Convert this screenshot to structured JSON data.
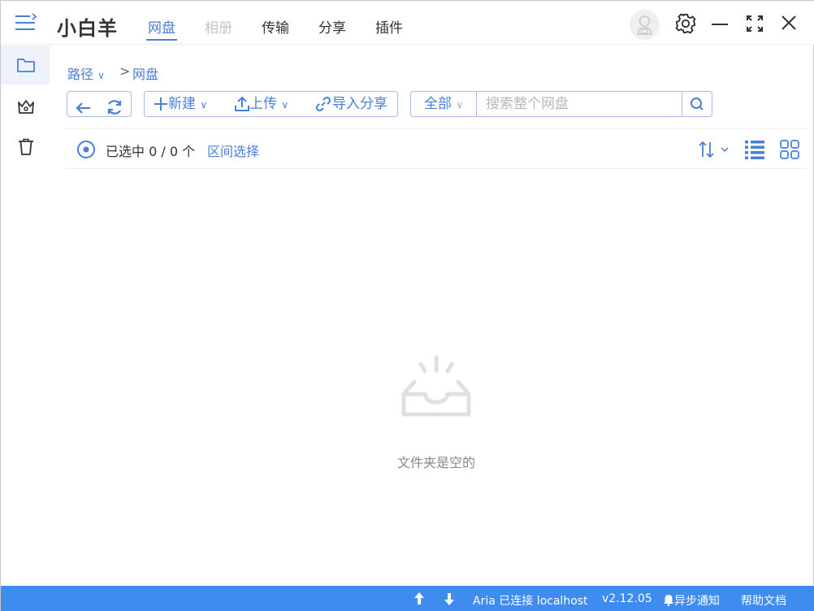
{
  "app": {
    "title": "小白羊"
  },
  "nav": {
    "tabs": [
      {
        "label": "网盘",
        "state": "active"
      },
      {
        "label": "相册",
        "state": "disabled"
      },
      {
        "label": "传输",
        "state": "normal"
      },
      {
        "label": "分享",
        "state": "normal"
      },
      {
        "label": "插件",
        "state": "normal"
      }
    ]
  },
  "window_controls": [
    "settings-icon",
    "minimize-icon",
    "maximize-icon",
    "close-icon"
  ],
  "sidebar": {
    "items": [
      {
        "icon": "folder-icon",
        "active": true
      },
      {
        "icon": "crown-icon",
        "active": false
      },
      {
        "icon": "trash-icon",
        "active": false
      }
    ]
  },
  "breadcrumb": {
    "root_label": "路径",
    "root_chevron": "∨",
    "separator": ">",
    "current": "网盘"
  },
  "toolbar": {
    "new_label": "新建",
    "upload_label": "上传",
    "import_share_label": "导入分享",
    "dropdown_chevron": "∨"
  },
  "search": {
    "scope_label": "全部",
    "placeholder": "搜索整个网盘",
    "value": ""
  },
  "selection": {
    "label": "已选中",
    "count": "0 / 0 个",
    "range_select_label": "区间选择"
  },
  "empty_state": {
    "text": "文件夹是空的"
  },
  "statusbar": {
    "aria_status": "Aria 已连接 localhost",
    "version": "v2.12.05",
    "notify_label": "异步通知",
    "help_label": "帮助文档"
  },
  "colors": {
    "accent": "#4a7fd8",
    "statusbar_bg": "#3f8cf0",
    "border": "#a8bde8",
    "disabled_text": "#c4c4c4",
    "empty_icon": "#e0e0e0"
  }
}
